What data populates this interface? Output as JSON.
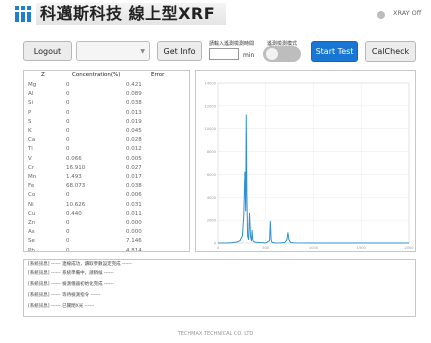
{
  "header": {
    "title": "科邁斯科技 線上型XRF",
    "xray_label": "XRAY Off"
  },
  "toolbar": {
    "logout_label": "Logout",
    "select_value": "",
    "get_info_label": "Get Info",
    "time_label": "請輸入遙測檢測時間",
    "time_value": "",
    "time_unit": "min",
    "mode_label": "遙測檢測模式",
    "start_label": "Start Test",
    "calcheck_label": "CalCheck"
  },
  "table": {
    "columns": [
      "Z",
      "Concentration(%)",
      "Error"
    ],
    "rows": [
      {
        "z": "Mg",
        "conc": "0",
        "err": "0.421"
      },
      {
        "z": "Al",
        "conc": "0",
        "err": "0.089"
      },
      {
        "z": "Si",
        "conc": "0",
        "err": "0.038"
      },
      {
        "z": "P",
        "conc": "0",
        "err": "0.013"
      },
      {
        "z": "S",
        "conc": "0",
        "err": "0.019"
      },
      {
        "z": "K",
        "conc": "0",
        "err": "0.045"
      },
      {
        "z": "Ca",
        "conc": "0",
        "err": "0.028"
      },
      {
        "z": "Ti",
        "conc": "0",
        "err": "0.012"
      },
      {
        "z": "V",
        "conc": "0.066",
        "err": "0.005"
      },
      {
        "z": "Cr",
        "conc": "16.910",
        "err": "0.027"
      },
      {
        "z": "Mn",
        "conc": "1.493",
        "err": "0.017"
      },
      {
        "z": "Fe",
        "conc": "68.073",
        "err": "0.038"
      },
      {
        "z": "Co",
        "conc": "0",
        "err": "0.006"
      },
      {
        "z": "Ni",
        "conc": "10.626",
        "err": "0.031"
      },
      {
        "z": "Cu",
        "conc": "0.440",
        "err": "0.011"
      },
      {
        "z": "Zn",
        "conc": "0",
        "err": "0.000"
      },
      {
        "z": "As",
        "conc": "0",
        "err": "0.000"
      },
      {
        "z": "Se",
        "conc": "0",
        "err": "7.146"
      },
      {
        "z": "Pb",
        "conc": "0",
        "err": "4.814"
      }
    ]
  },
  "chart_data": {
    "type": "line",
    "title": "",
    "xlabel": "",
    "ylabel": "",
    "color": "#2f8fd8",
    "xlim": [
      0,
      2000
    ],
    "ylim": [
      0,
      14000
    ],
    "xticks": [
      "0",
      "500",
      "1000",
      "1500",
      "2000"
    ],
    "yticks": [
      "0",
      "2000",
      "4000",
      "6000",
      "8000",
      "10000",
      "12000",
      "14000"
    ],
    "x": [
      0,
      100,
      150,
      200,
      230,
      255,
      270,
      282,
      290,
      296,
      302,
      310,
      320,
      330,
      340,
      350,
      357,
      363,
      370,
      380,
      390,
      400,
      450,
      500,
      540,
      548,
      556,
      565,
      600,
      650,
      700,
      722,
      732,
      742,
      760,
      800,
      1000,
      1500,
      2000
    ],
    "y": [
      0,
      0,
      30,
      100,
      200,
      600,
      2400,
      6200,
      2800,
      11200,
      4500,
      600,
      300,
      2600,
      600,
      200,
      1100,
      300,
      150,
      100,
      80,
      60,
      30,
      10,
      200,
      1900,
      300,
      50,
      10,
      0,
      50,
      300,
      900,
      300,
      50,
      10,
      0,
      0,
      0
    ]
  },
  "log": {
    "lines": [
      "[系統訊息] ------ 連線成功，讀取參數設定完成 ------",
      "[系統訊息] ------ 系統準備中，請稍候 ------",
      "[系統訊息] ------ 檢測儀器初始化完成 ------",
      "[系統訊息] ------ 等待檢測指令 ------",
      "[系統訊息] ------ 已關閉X光 ------"
    ]
  },
  "footer": {
    "company": "TECHMAX TECHNICAL CO. LTD"
  }
}
